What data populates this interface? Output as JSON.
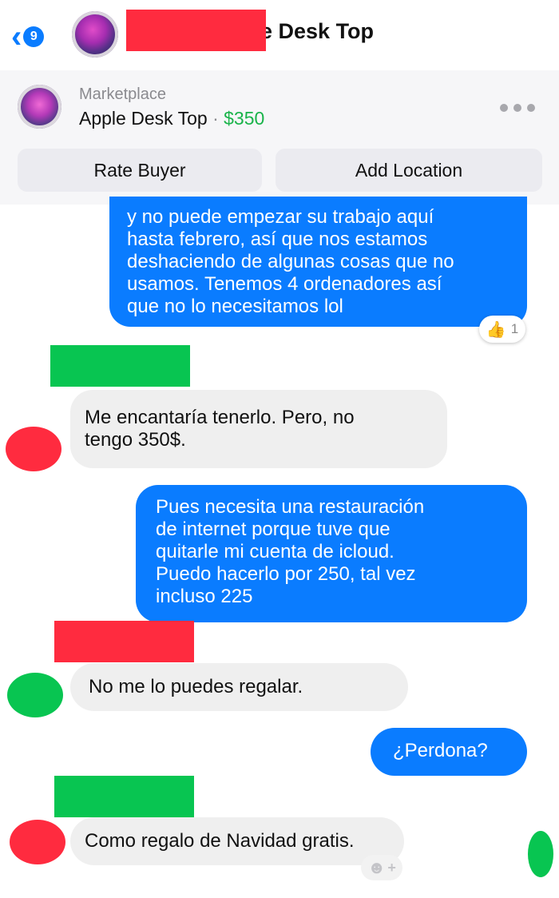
{
  "header": {
    "back_badge": "9",
    "title_visible": "e Desk Top"
  },
  "listing": {
    "source": "Marketplace",
    "title": "Apple Desk Top",
    "separator": "·",
    "price": "$350",
    "actions": [
      "Rate Buyer",
      "Add Location"
    ]
  },
  "messages": [
    {
      "from": "me",
      "text": "y no puede empezar su trabajo aquí\nhasta febrero, así que nos estamos\ndeshaciendo de algunas cosas que no\nusamos. Tenemos 4 ordenadores así\nque no lo necesitamos lol"
    },
    {
      "from": "buyer",
      "text": "Me encantaría tenerlo. Pero, no\ntengo 350$."
    },
    {
      "from": "me",
      "text": "Pues necesita una restauración\nde internet porque tuve que\nquitarle mi cuenta de icloud.\nPuedo hacerlo por 250, tal vez\nincluso 225"
    },
    {
      "from": "buyer",
      "text": "No me lo puedes regalar."
    },
    {
      "from": "me",
      "text": "¿Perdona?"
    },
    {
      "from": "buyer",
      "text": "Como regalo de Navidad gratis."
    }
  ],
  "reaction": {
    "icon": "👍",
    "count": "1"
  },
  "colors": {
    "accent": "#0a7cff",
    "price": "#19b34a",
    "redact_red": "#ff2b3f",
    "redact_green": "#08c551"
  }
}
